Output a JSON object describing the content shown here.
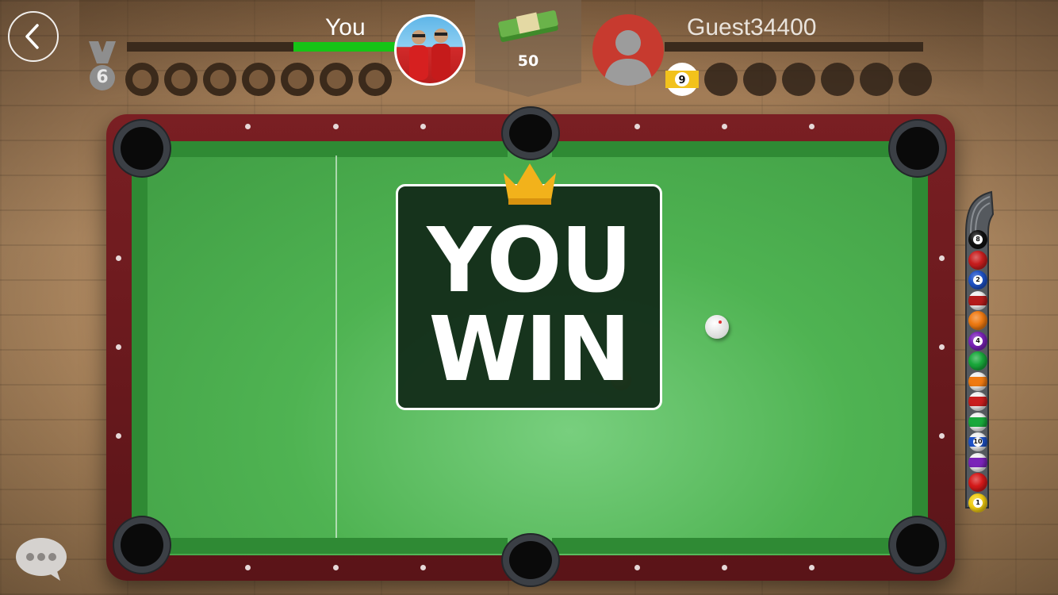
{
  "hud": {
    "player_name": "You",
    "opponent_name": "Guest34400",
    "level": "6",
    "stake_amount": "50",
    "player_progress": 0.38,
    "opponent_progress": 0.0,
    "player_assigned_ball": "",
    "opponent_assigned_ball": "9"
  },
  "result": {
    "line1": "YOU",
    "line2": "WIN"
  },
  "icons": {
    "back": "chevron-left-icon",
    "level": "medal-icon",
    "stake": "cash-stack-icon",
    "crown": "crown-icon",
    "chat": "chat-bubble-icon"
  },
  "colors": {
    "felt": "#4fb352",
    "rail": "#7a1f23",
    "progress": "#16c416",
    "crown": "#f2b21b"
  },
  "rack_balls": [
    {
      "label": "8",
      "color": "#111111",
      "stripe": false
    },
    {
      "label": "",
      "color": "#c81e1e",
      "stripe": false
    },
    {
      "label": "2",
      "color": "#1f52c6",
      "stripe": false
    },
    {
      "label": "",
      "color": "#b41c1c",
      "stripe": true
    },
    {
      "label": "",
      "color": "#ef7a12",
      "stripe": false
    },
    {
      "label": "4",
      "color": "#7a23b8",
      "stripe": false
    },
    {
      "label": "",
      "color": "#19a83b",
      "stripe": false
    },
    {
      "label": "",
      "color": "#ef7a12",
      "stripe": true
    },
    {
      "label": "",
      "color": "#c81e1e",
      "stripe": true
    },
    {
      "label": "",
      "color": "#19a83b",
      "stripe": true
    },
    {
      "label": "10",
      "color": "#1f52c6",
      "stripe": true
    },
    {
      "label": "",
      "color": "#7a23b8",
      "stripe": true
    },
    {
      "label": "",
      "color": "#d61a1a",
      "stripe": false
    },
    {
      "label": "1",
      "color": "#f2cd12",
      "stripe": false
    }
  ]
}
